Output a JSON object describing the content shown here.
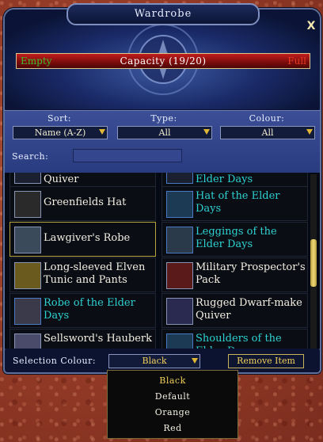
{
  "window": {
    "title": "Wardrobe",
    "close_label": "X"
  },
  "capacity": {
    "empty_label": "Empty",
    "text": "Capacity (19/20)",
    "full_label": "Full",
    "used": 19,
    "max": 20
  },
  "filters": {
    "sort": {
      "label": "Sort:",
      "value": "Name (A-Z)"
    },
    "type": {
      "label": "Type:",
      "value": "All"
    },
    "colour": {
      "label": "Colour:",
      "value": "All"
    },
    "search": {
      "label": "Search:",
      "value": ""
    }
  },
  "items": [
    {
      "name": "Quiver",
      "rare": false,
      "icon": "quiver-icon"
    },
    {
      "name": "Elder Days",
      "rare": true,
      "icon": "helm-icon"
    },
    {
      "name": "Greenfields Hat",
      "rare": false,
      "icon": "hat-icon"
    },
    {
      "name": "Hat of the Elder Days",
      "rare": true,
      "icon": "helm-icon"
    },
    {
      "name": "Lawgiver's Robe",
      "rare": false,
      "icon": "robe-icon",
      "selected": true
    },
    {
      "name": "Leggings of the Elder Days",
      "rare": true,
      "icon": "leggings-icon"
    },
    {
      "name": "Long-sleeved Elven Tunic and Pants",
      "rare": false,
      "icon": "tunic-icon"
    },
    {
      "name": "Military Prospector's Pack",
      "rare": false,
      "icon": "pack-icon"
    },
    {
      "name": "Robe of the Elder Days",
      "rare": true,
      "icon": "robe-icon"
    },
    {
      "name": "Rugged Dwarf-make Quiver",
      "rare": false,
      "icon": "quiver-icon"
    },
    {
      "name": "Sellsword's Hauberk",
      "rare": false,
      "icon": "hauberk-icon"
    },
    {
      "name": "Shoulders of the Elder Days",
      "rare": true,
      "icon": "shoulders-icon"
    }
  ],
  "bottom": {
    "selection_label": "Selection Colour:",
    "selection_value": "Black",
    "remove_label": "Remove Item"
  },
  "colour_menu": {
    "options": [
      "Black",
      "Default",
      "Orange",
      "Red"
    ],
    "selected": "Black"
  },
  "colors": {
    "rare_text": "#2ed1d1",
    "normal_text": "#f3efe3",
    "accent_gold": "#f2cf5b"
  }
}
